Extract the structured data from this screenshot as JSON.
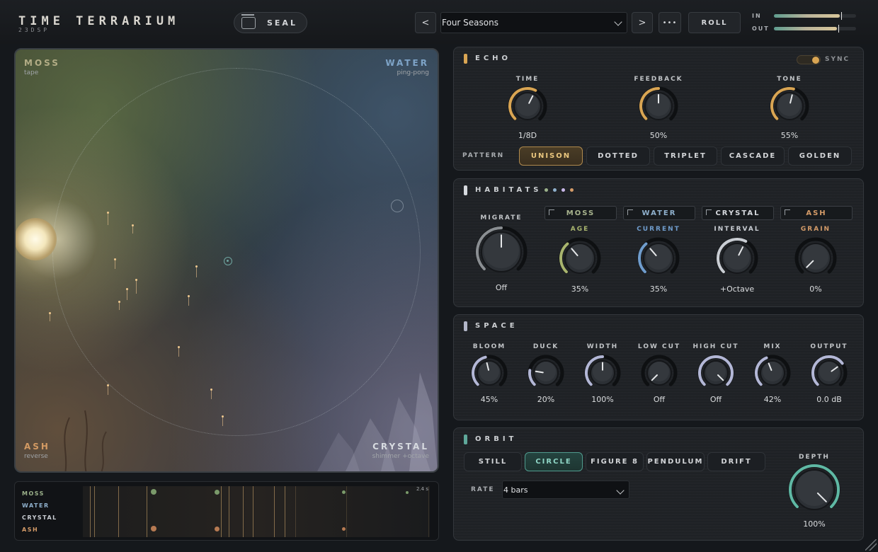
{
  "header": {
    "app_title": "TIME TERRARIUM",
    "app_subtitle": "23DSP",
    "seal_label": "SEAL",
    "prev_label": "<",
    "next_label": ">",
    "preset_name": "Four Seasons",
    "more_label": "•••",
    "roll_label": "ROLL",
    "meters": [
      {
        "label": "IN",
        "level": 0.8
      },
      {
        "label": "OUT",
        "level": 0.77
      }
    ]
  },
  "stage": {
    "corners": [
      {
        "name": "MOSS",
        "sub": "tape",
        "color": "#b3ad86"
      },
      {
        "name": "WATER",
        "sub": "ping-pong",
        "color": "#7ea4c8"
      },
      {
        "name": "ASH",
        "sub": "reverse",
        "color": "#d39a63"
      },
      {
        "name": "CRYSTAL",
        "sub": "shimmer +octave",
        "color": "#d7dbe0"
      }
    ]
  },
  "timeline": {
    "tracks": [
      {
        "label": "MOSS",
        "color": "#9bb18a"
      },
      {
        "label": "WATER",
        "color": "#8fb0cc"
      },
      {
        "label": "CRYSTAL",
        "color": "#c9cdd3"
      },
      {
        "label": "ASH",
        "color": "#d49b68"
      }
    ],
    "scale_label": "2.4 s"
  },
  "echo": {
    "title": "ECHO",
    "led_color": "#d9a553",
    "sync_label": "SYNC",
    "knobs": [
      {
        "label": "TIME",
        "value": "1/8D",
        "level": 0.6
      },
      {
        "label": "FEEDBACK",
        "value": "50%",
        "level": 0.5
      },
      {
        "label": "TONE",
        "value": "55%",
        "level": 0.55
      }
    ],
    "pattern_label": "PATTERN",
    "patterns": [
      "UNISON",
      "DOTTED",
      "TRIPLET",
      "CASCADE",
      "GOLDEN"
    ],
    "active_pattern": "UNISON"
  },
  "habitats": {
    "title": "HABITATS",
    "dots": [
      "#9bb18a",
      "#8fb0cc",
      "#c9b8e8",
      "#d49b68"
    ],
    "migrate": {
      "label": "MIGRATE",
      "value": "Off",
      "level": 0.5
    },
    "tabs": [
      {
        "label": "MOSS",
        "color": "#a8b48e"
      },
      {
        "label": "WATER",
        "color": "#8fb0cc"
      },
      {
        "label": "CRYSTAL",
        "color": "#d6d9de"
      },
      {
        "label": "ASH",
        "color": "#d49b68"
      }
    ],
    "knobs": [
      {
        "label": "AGE",
        "value": "35%",
        "level": 0.35,
        "color": "#a8b46e"
      },
      {
        "label": "CURRENT",
        "value": "35%",
        "level": 0.35,
        "color": "#6f9ccc"
      },
      {
        "label": "INTERVAL",
        "value": "+Octave",
        "level": 0.6,
        "color": "#c9cdd3"
      },
      {
        "label": "GRAIN",
        "value": "0%",
        "level": 0.0,
        "color": "#d49b68"
      }
    ]
  },
  "space": {
    "title": "SPACE",
    "knobs": [
      {
        "label": "BLOOM",
        "value": "45%",
        "level": 0.45
      },
      {
        "label": "DUCK",
        "value": "20%",
        "level": 0.2
      },
      {
        "label": "WIDTH",
        "value": "100%",
        "level": 0.5
      },
      {
        "label": "LOW CUT",
        "value": "Off",
        "level": 0.0
      },
      {
        "label": "HIGH CUT",
        "value": "Off",
        "level": 1.0
      },
      {
        "label": "MIX",
        "value": "42%",
        "level": 0.42
      },
      {
        "label": "OUTPUT",
        "value": "0.0 dB",
        "level": 0.7
      }
    ]
  },
  "orbit": {
    "title": "ORBIT",
    "modes": [
      "STILL",
      "CIRCLE",
      "FIGURE 8",
      "PENDULUM",
      "DRIFT"
    ],
    "active_mode": "CIRCLE",
    "rate_label": "RATE",
    "rate_value": "4 bars",
    "depth": {
      "label": "DEPTH",
      "value": "100%",
      "level": 1.0
    }
  }
}
